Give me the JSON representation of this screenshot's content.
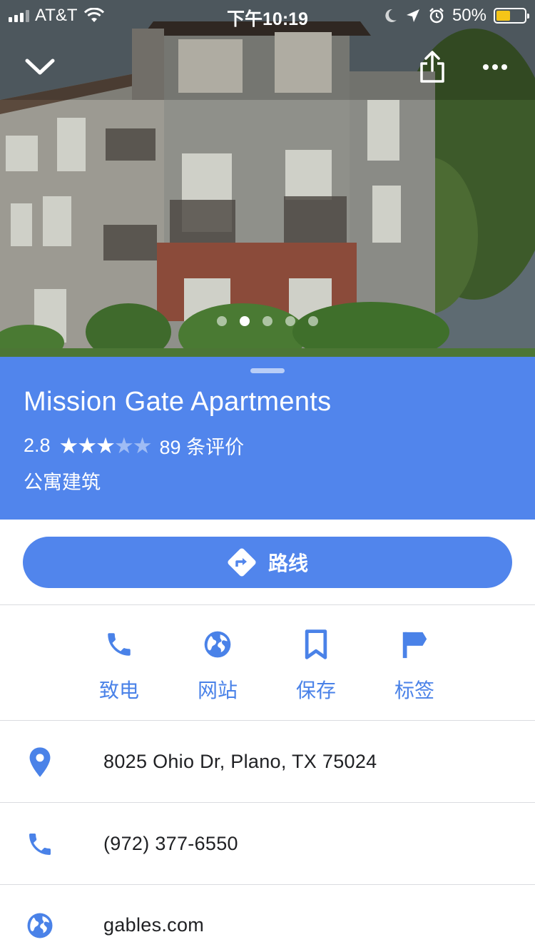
{
  "status_bar": {
    "carrier": "AT&T",
    "time": "下午10:19",
    "battery": "50%",
    "battery_level": 0.5
  },
  "header": {
    "collapse_icon": "chevron-down-icon",
    "share_icon": "share-icon",
    "more_icon": "more-horizontal-icon",
    "photo_count": 5,
    "active_photo_index": 1
  },
  "place": {
    "name": "Mission Gate Apartments",
    "rating": "2.8",
    "rating_value": 2.8,
    "max_rating": 5,
    "reviews": "89 条评价",
    "category": "公寓建筑"
  },
  "directions": {
    "label": "路线"
  },
  "actions": [
    {
      "label": "致电",
      "icon": "phone-icon"
    },
    {
      "label": "网站",
      "icon": "globe-icon"
    },
    {
      "label": "保存",
      "icon": "bookmark-icon"
    },
    {
      "label": "标签",
      "icon": "flag-icon"
    }
  ],
  "details": {
    "address": "8025 Ohio Dr, Plano, TX 75024",
    "phone": "(972) 377-6550",
    "website": "gables.com"
  },
  "colors": {
    "accent": "#5185ec",
    "icon_blue": "#4a82e8",
    "divider": "#dadce0",
    "text": "#202124"
  }
}
